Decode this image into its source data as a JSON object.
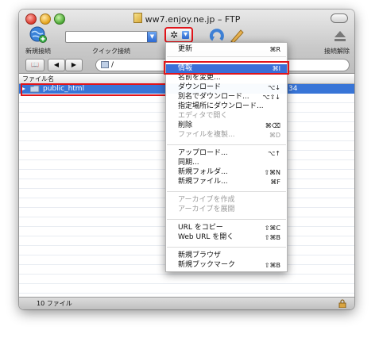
{
  "window": {
    "title": "ww7.enjoy.ne.jp – FTP"
  },
  "toolbar": {
    "new_connection_label": "新規接続",
    "quick_connect_label": "クイック接続",
    "disconnect_label": "接続解除",
    "quick_connect_value": ""
  },
  "nav": {
    "path": "/"
  },
  "list": {
    "header_name": "ファイル名",
    "rows": [
      {
        "name": "public_html",
        "time": ":34",
        "selected": true
      }
    ]
  },
  "status": {
    "count_text": "10 ファイル"
  },
  "menu": {
    "items": [
      {
        "label": "更新",
        "shortcut": "⌘R",
        "disabled": false,
        "highlighted": false
      },
      {
        "label": "情報",
        "shortcut": "⌘I",
        "disabled": false,
        "highlighted": true
      },
      {
        "label": "名前を変更...",
        "shortcut": "",
        "disabled": false,
        "highlighted": false
      },
      {
        "label": "ダウンロード",
        "shortcut": "⌥↓",
        "disabled": false,
        "highlighted": false
      },
      {
        "label": "別名でダウンロード...",
        "shortcut": "⌥⇧↓",
        "disabled": false,
        "highlighted": false
      },
      {
        "label": "指定場所にダウンロード...",
        "shortcut": "",
        "disabled": false,
        "highlighted": false
      },
      {
        "label": "エディタで開く",
        "shortcut": "",
        "disabled": true,
        "highlighted": false
      },
      {
        "label": "削除",
        "shortcut": "⌘⌫",
        "disabled": false,
        "highlighted": false
      },
      {
        "label": "ファイルを複製...",
        "shortcut": "⌘D",
        "disabled": true,
        "highlighted": false
      },
      {
        "label": "アップロード...",
        "shortcut": "⌥↑",
        "disabled": false,
        "highlighted": false
      },
      {
        "label": "同期...",
        "shortcut": "",
        "disabled": false,
        "highlighted": false
      },
      {
        "label": "新規フォルダ...",
        "shortcut": "⇧⌘N",
        "disabled": false,
        "highlighted": false
      },
      {
        "label": "新規ファイル...",
        "shortcut": "⌘F",
        "disabled": false,
        "highlighted": false
      },
      {
        "label": "アーカイブを作成",
        "shortcut": "",
        "disabled": true,
        "highlighted": false
      },
      {
        "label": "アーカイブを展開",
        "shortcut": "",
        "disabled": true,
        "highlighted": false
      },
      {
        "label": "URL をコピー",
        "shortcut": "⇧⌘C",
        "disabled": false,
        "highlighted": false
      },
      {
        "label": "Web URL を開く",
        "shortcut": "⇧⌘B",
        "disabled": false,
        "highlighted": false
      },
      {
        "label": "新規ブラウザ",
        "shortcut": "",
        "disabled": false,
        "highlighted": false
      },
      {
        "label": "新規ブックマーク",
        "shortcut": "⇧⌘B",
        "disabled": false,
        "highlighted": false
      }
    ]
  },
  "colors": {
    "highlight": "#3a6fd8",
    "selection": "#3875d7",
    "annotation": "#e0141a"
  }
}
